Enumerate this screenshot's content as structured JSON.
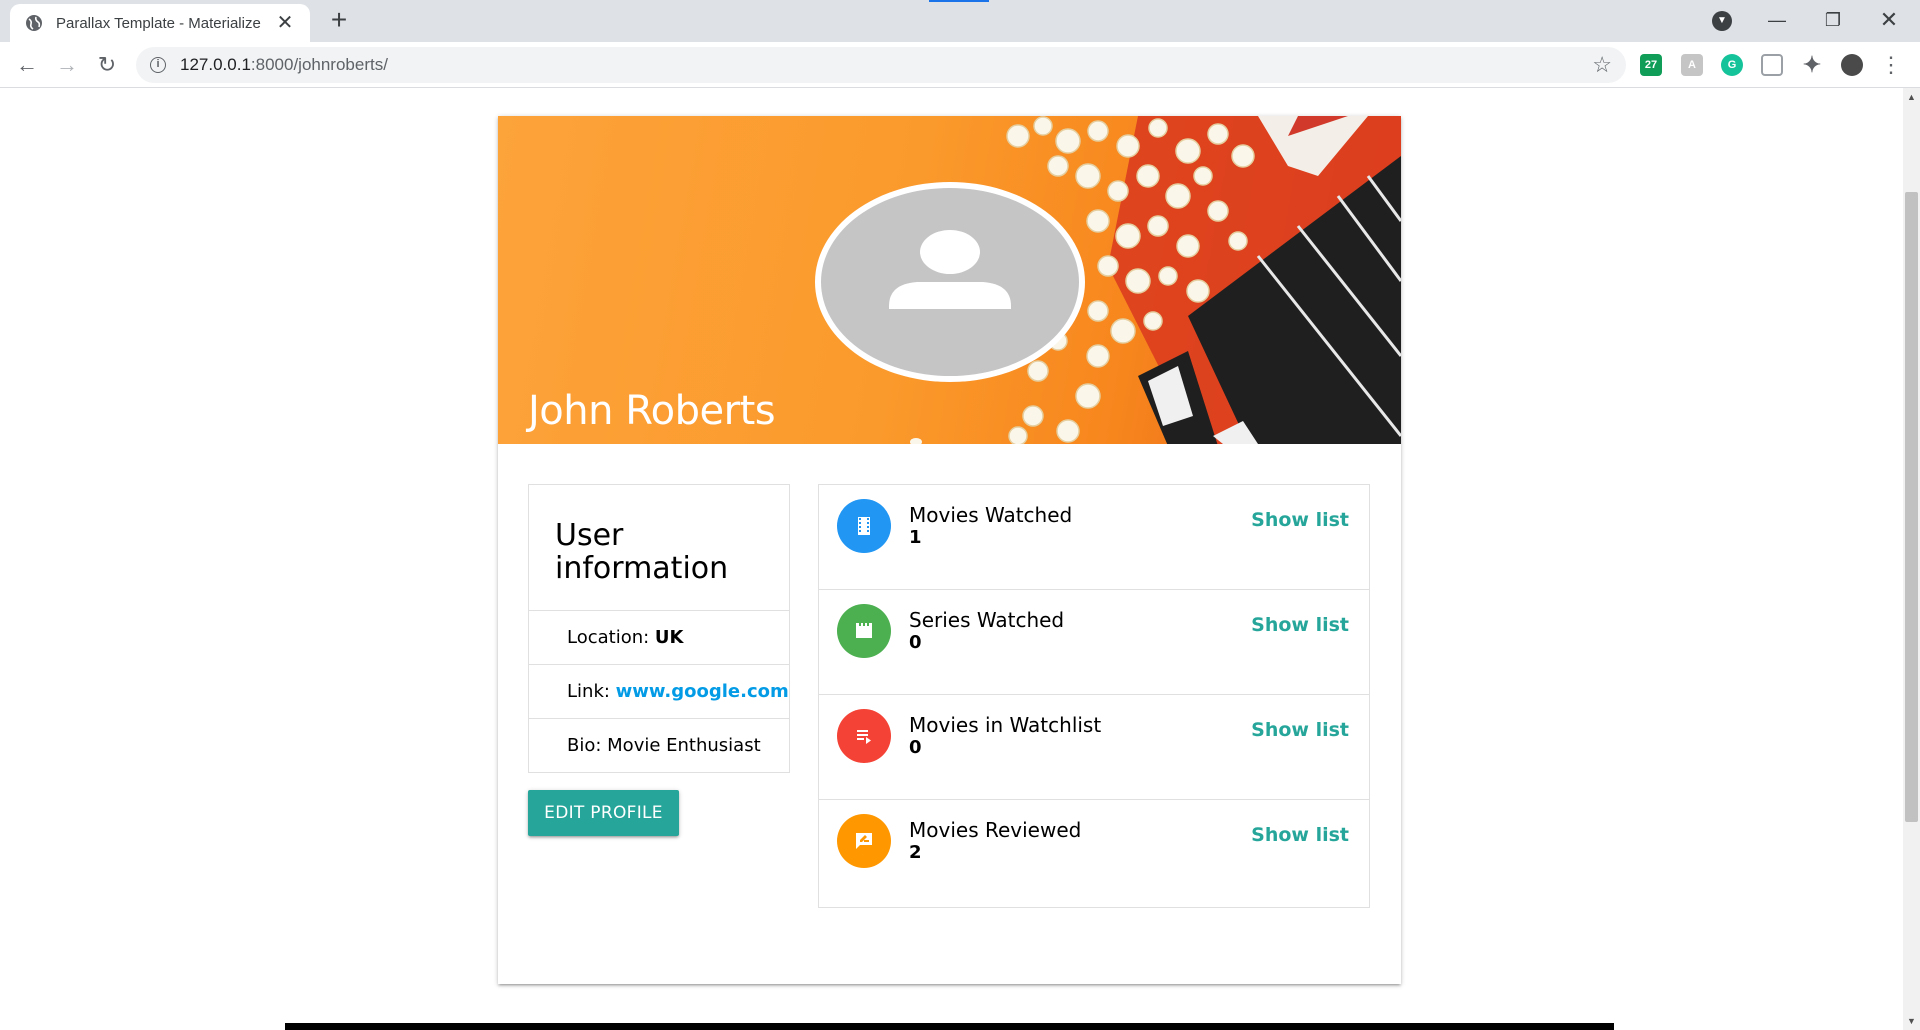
{
  "browser": {
    "tab_title": "Parallax Template - Materialize",
    "tab_close": "✕",
    "new_tab": "+",
    "url_host": "127.0.0.1",
    "url_path": ":8000/johnroberts/",
    "extension_badge": "27"
  },
  "profile": {
    "name": "John Roberts"
  },
  "user_info": {
    "title": "User information",
    "location_label": "Location: ",
    "location_value": "UK",
    "link_label": "Link: ",
    "link_value": "www.google.com",
    "bio": "Bio: Movie Enthusiast",
    "edit_button": "EDIT PROFILE"
  },
  "stats": [
    {
      "title": "Movies Watched",
      "count": "1",
      "link": "Show list",
      "color": "#2196f3",
      "icon": "movie-film-icon"
    },
    {
      "title": "Series Watched",
      "count": "0",
      "link": "Show list",
      "color": "#4caf50",
      "icon": "clapperboard-icon"
    },
    {
      "title": "Movies in Watchlist",
      "count": "0",
      "link": "Show list",
      "color": "#f44336",
      "icon": "playlist-play-icon"
    },
    {
      "title": "Movies Reviewed",
      "count": "2",
      "link": "Show list",
      "color": "#ff9800",
      "icon": "rate-review-icon"
    }
  ],
  "colors": {
    "accent": "#26a69a",
    "link": "#039be5"
  }
}
